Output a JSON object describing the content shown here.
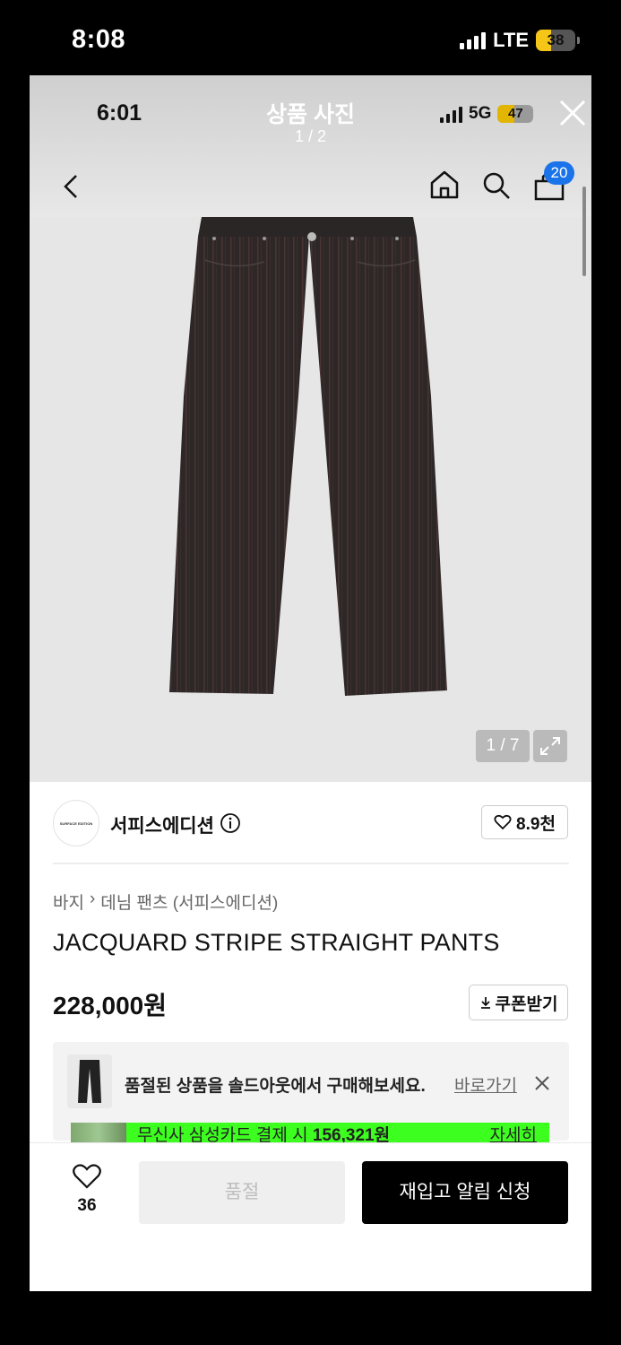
{
  "outer_status": {
    "time": "8:08",
    "network": "LTE",
    "battery": "38"
  },
  "inner_status": {
    "time": "6:01",
    "network": "5G",
    "battery": "47"
  },
  "viewer": {
    "title": "상품 사진",
    "count": "1 / 2"
  },
  "header": {
    "cart_count": "20"
  },
  "icons": {
    "back": "chevron-left-icon",
    "home": "home-icon",
    "search": "search-icon",
    "cart": "shopping-bag-icon",
    "close": "close-icon",
    "expand": "expand-icon",
    "heart": "heart-icon",
    "info": "info-icon",
    "download": "download-icon"
  },
  "product_image": {
    "counter": "1 / 7"
  },
  "brand": {
    "name": "서피스에디션",
    "logo_text": "SURFACE EDITION",
    "likes": "8.9천"
  },
  "breadcrumb": [
    "바지",
    "데님 팬츠 (서피스에디션)"
  ],
  "product": {
    "name": "JACQUARD STRIPE STRAIGHT PANTS",
    "price": "228,000원",
    "coupon_label": "쿠폰받기"
  },
  "soldout_notice": {
    "text": "품절된 상품을 솔드아웃에서 구매해보세요.",
    "link": "바로가기"
  },
  "card_banner": {
    "text_prefix": "무신사 삼성카드 결제 시 ",
    "amount": "156,321원",
    "link": "자세히"
  },
  "bottom": {
    "wish_count": "36",
    "soldout_label": "품절",
    "restock_label": "재입고 알림 신청"
  },
  "colors": {
    "accent_badge": "#1a73e8",
    "banner_green": "#3dff1f",
    "cta_black": "#000000"
  }
}
